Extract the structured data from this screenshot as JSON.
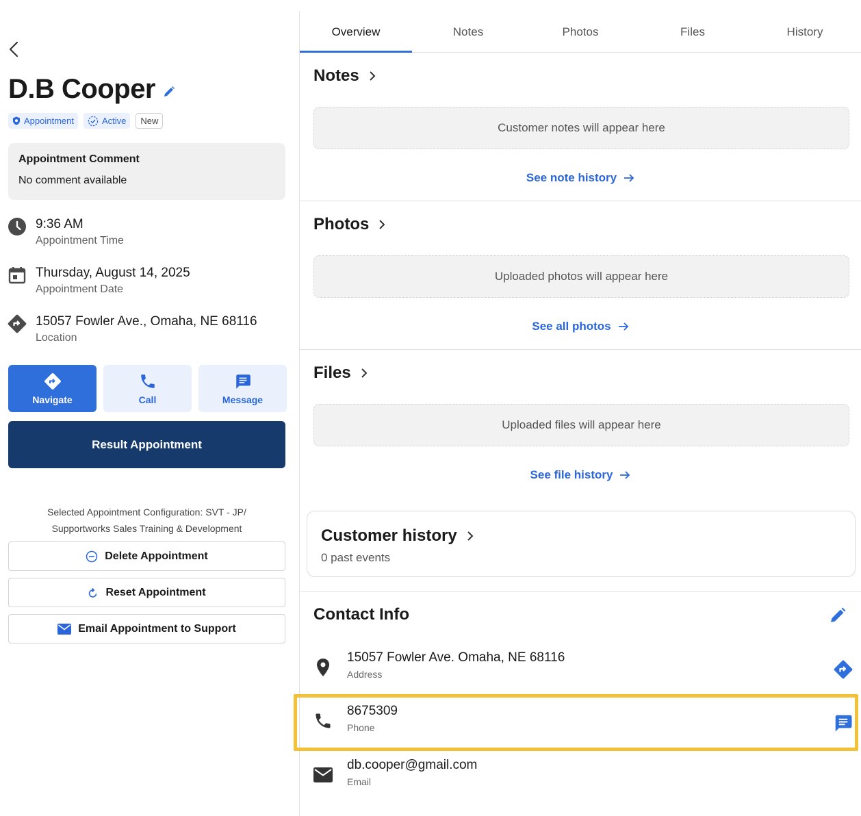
{
  "customer": {
    "name": "D.B Cooper",
    "badges": {
      "type": "Appointment",
      "status": "Active",
      "tag": "New"
    }
  },
  "comment": {
    "title": "Appointment Comment",
    "body": "No comment available"
  },
  "details": {
    "time": {
      "value": "9:36 AM",
      "label": "Appointment Time"
    },
    "date": {
      "value": "Thursday, August 14, 2025",
      "label": "Appointment Date"
    },
    "location": {
      "value": "15057 Fowler Ave., Omaha, NE 68116",
      "label": "Location"
    }
  },
  "actions": {
    "navigate": "Navigate",
    "call": "Call",
    "message": "Message",
    "result": "Result Appointment"
  },
  "config": {
    "line1": "Selected Appointment Configuration: SVT - JP/",
    "line2": "Supportworks Sales Training & Development"
  },
  "admin": {
    "delete": "Delete Appointment",
    "reset": "Reset Appointment",
    "email": "Email Appointment to Support"
  },
  "tabs": [
    "Overview",
    "Notes",
    "Photos",
    "Files",
    "History"
  ],
  "active_tab": "Overview",
  "sections": {
    "notes": {
      "title": "Notes",
      "placeholder": "Customer notes will appear here",
      "link": "See note history"
    },
    "photos": {
      "title": "Photos",
      "placeholder": "Uploaded photos will appear here",
      "link": "See all photos"
    },
    "files": {
      "title": "Files",
      "placeholder": "Uploaded files will appear here",
      "link": "See file history"
    }
  },
  "history": {
    "title": "Customer history",
    "subtitle": "0 past events"
  },
  "contact": {
    "title": "Contact Info",
    "address": {
      "value": "15057 Fowler Ave.  Omaha, NE 68116",
      "label": "Address"
    },
    "phone": {
      "value": "8675309",
      "label": "Phone"
    },
    "email": {
      "value": "db.cooper@gmail.com",
      "label": "Email"
    }
  },
  "colors": {
    "primary": "#2f6fdc",
    "navy": "#163a6b",
    "highlight": "#f2c138",
    "soft": "#eaf1fd"
  }
}
